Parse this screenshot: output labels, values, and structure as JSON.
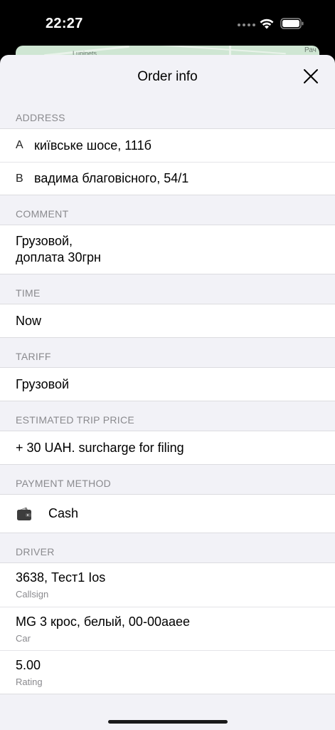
{
  "status_bar": {
    "time": "22:27"
  },
  "map": {
    "label_left": "Lupinets",
    "label_right": "Рач"
  },
  "sheet": {
    "title": "Order info"
  },
  "address": {
    "header": "ADDRESS",
    "items": [
      {
        "letter": "A",
        "text": "київське шосе, 111б"
      },
      {
        "letter": "B",
        "text": "вадима благовісного, 54/1"
      }
    ]
  },
  "comment": {
    "header": "COMMENT",
    "line1": "Грузовой,",
    "line2": "доплата 30грн"
  },
  "time": {
    "header": "TIME",
    "value": "Now"
  },
  "tariff": {
    "header": "TARIFF",
    "value": "Грузовой"
  },
  "price": {
    "header": "ESTIMATED TRIP PRICE",
    "value": "+ 30 UAH. surcharge for filing"
  },
  "payment": {
    "header": "PAYMENT METHOD",
    "icon": "wallet-icon",
    "value": "Cash"
  },
  "driver": {
    "header": "DRIVER",
    "items": [
      {
        "value": "3638, Тест1 Ios",
        "label": "Callsign"
      },
      {
        "value": "MG 3 крос, белый, 00-00ааее",
        "label": "Car"
      },
      {
        "value": "5.00",
        "label": "Rating"
      }
    ]
  },
  "colors": {
    "background": "#f2f2f7",
    "secondary_text": "#8a8a8e",
    "separator": "#dcdce0"
  }
}
